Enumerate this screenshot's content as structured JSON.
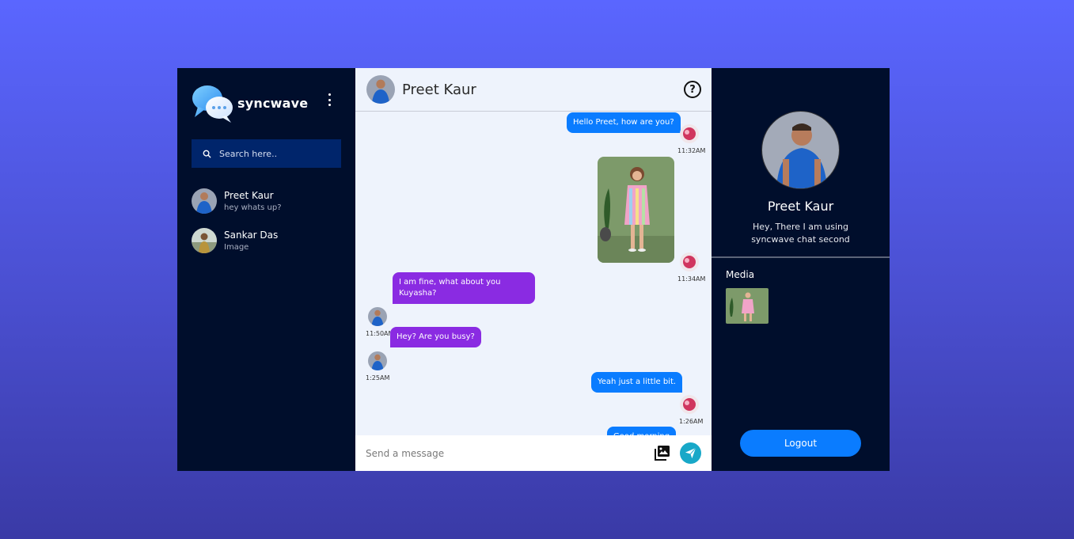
{
  "app": {
    "name": "syncwave"
  },
  "search": {
    "placeholder": "Search here.."
  },
  "contacts": [
    {
      "name": "Preet Kaur",
      "last": "hey whats up?"
    },
    {
      "name": "Sankar Das",
      "last": "Image"
    }
  ],
  "chat": {
    "name": "Preet Kaur",
    "messages": [
      {
        "dir": "out",
        "text": "Hello Preet, how are you?",
        "time": "11:32AM"
      },
      {
        "dir": "out",
        "type": "image",
        "time": "11:34AM"
      },
      {
        "dir": "in",
        "text": "I am fine, what about you Kuyasha?",
        "time": "11:50AM"
      },
      {
        "dir": "in",
        "text": "Hey? Are you busy?",
        "time": "1:25AM"
      },
      {
        "dir": "out",
        "text": "Yeah just a little bit.",
        "time": "1:26AM"
      },
      {
        "dir": "out",
        "text": "Good morning"
      }
    ],
    "input_placeholder": "Send a message"
  },
  "profile": {
    "name": "Preet Kaur",
    "status": "Hey, There I am using syncwave chat second",
    "media_title": "Media",
    "logout_label": "Logout"
  },
  "colors": {
    "sidebar_bg": "#000e2c",
    "chat_bg": "#eef3fc",
    "outgoing": "#0a7cff",
    "incoming": "#8a2be2",
    "send": "#18a8c8"
  },
  "icons": [
    "chat-bubbles-logo-icon",
    "kebab-menu-icon",
    "search-icon",
    "help-icon",
    "gallery-icon",
    "send-icon"
  ]
}
